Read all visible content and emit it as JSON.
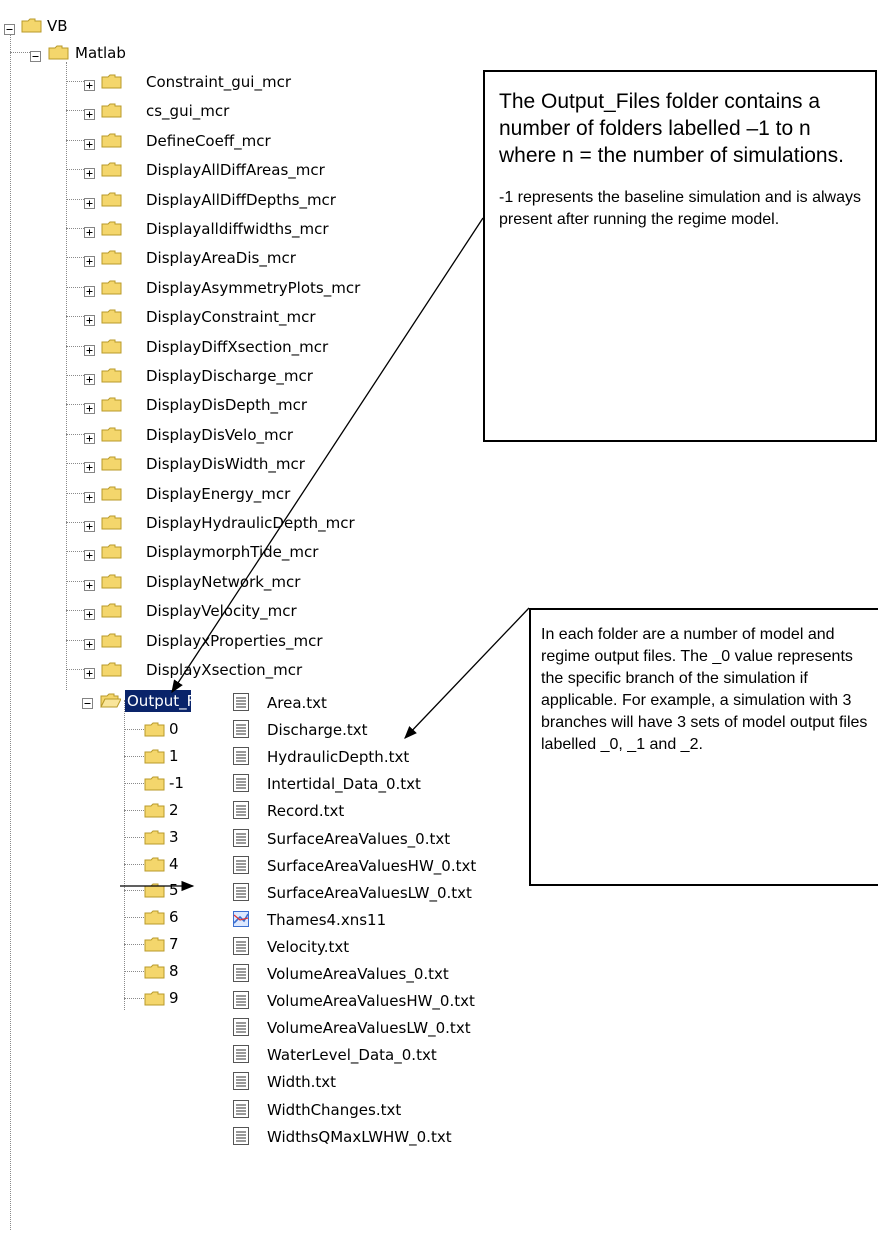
{
  "tree": {
    "root": "VB",
    "matlab": "Matlab",
    "folders": [
      "Constraint_gui_mcr",
      "cs_gui_mcr",
      "DefineCoeff_mcr",
      "DisplayAllDiffAreas_mcr",
      "DisplayAllDiffDepths_mcr",
      "Displayalldiffwidths_mcr",
      "DisplayAreaDis_mcr",
      "DisplayAsymmetryPlots_mcr",
      "DisplayConstraint_mcr",
      "DisplayDiffXsection_mcr",
      "DisplayDischarge_mcr",
      "DisplayDisDepth_mcr",
      "DisplayDisVelo_mcr",
      "DisplayDisWidth_mcr",
      "DisplayEnergy_mcr",
      "DisplayHydraulicDepth_mcr",
      "DisplaymorphTide_mcr",
      "DisplayNetwork_mcr",
      "DisplayVelocity_mcr",
      "DisplayxProperties_mcr",
      "DisplayXsection_mcr"
    ],
    "output_folder": "Output_F",
    "subfolders": [
      "0",
      "1",
      "-1",
      "2",
      "3",
      "4",
      "5",
      "6",
      "7",
      "8",
      "9"
    ]
  },
  "files": [
    "Area.txt",
    "Discharge.txt",
    "HydraulicDepth.txt",
    "Intertidal_Data_0.txt",
    "Record.txt",
    "SurfaceAreaValues_0.txt",
    "SurfaceAreaValuesHW_0.txt",
    "SurfaceAreaValuesLW_0.txt",
    "Thames4.xns11",
    "Velocity.txt",
    "VolumeAreaValues_0.txt",
    "VolumeAreaValuesHW_0.txt",
    "VolumeAreaValuesLW_0.txt",
    "WaterLevel_Data_0.txt",
    "Width.txt",
    "WidthChanges.txt",
    "WidthsQMaxLWHW_0.txt"
  ],
  "callouts": {
    "one_title": "The Output_Files folder contains a number of folders labelled –1 to n where n = the number of simulations.",
    "one_note": "-1 represents the baseline simulation and is always present after running the regime model.",
    "two_text": "In each folder are a number of model and regime output files. The _0 value represents the specific branch of the simulation if applicable. For example, a simulation with 3 branches will have 3 sets of model output files labelled _0, _1 and _2."
  },
  "colors": {
    "folder_fill": "#f4d66c",
    "folder_edge": "#b89a2a",
    "selection": "#0a246a",
    "xns_icon": "#3b6fd1"
  }
}
